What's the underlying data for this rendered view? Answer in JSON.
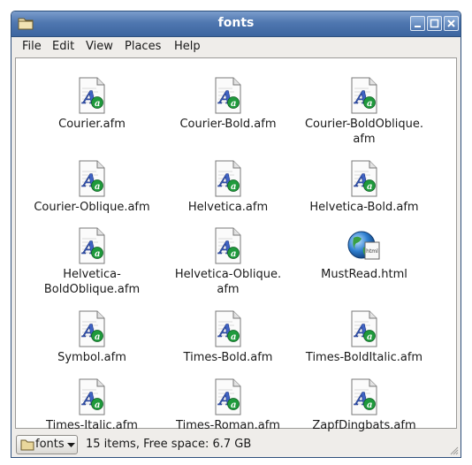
{
  "window": {
    "title": "fonts"
  },
  "menu": [
    "File",
    "Edit",
    "View",
    "Places",
    "Help"
  ],
  "files": [
    {
      "name": "Courier.afm",
      "icon": "font-file-icon"
    },
    {
      "name": "Courier-Bold.afm",
      "icon": "font-file-icon"
    },
    {
      "name": "Courier-BoldOblique.\nafm",
      "icon": "font-file-icon"
    },
    {
      "name": "Courier-Oblique.afm",
      "icon": "font-file-icon"
    },
    {
      "name": "Helvetica.afm",
      "icon": "font-file-icon"
    },
    {
      "name": "Helvetica-Bold.afm",
      "icon": "font-file-icon"
    },
    {
      "name": "Helvetica-\nBoldOblique.afm",
      "icon": "font-file-icon"
    },
    {
      "name": "Helvetica-Oblique.\nafm",
      "icon": "font-file-icon"
    },
    {
      "name": "MustRead.html",
      "icon": "html-file-icon",
      "badge": "html"
    },
    {
      "name": "Symbol.afm",
      "icon": "font-file-icon"
    },
    {
      "name": "Times-Bold.afm",
      "icon": "font-file-icon"
    },
    {
      "name": "Times-BoldItalic.afm",
      "icon": "font-file-icon"
    },
    {
      "name": "Times-Italic.afm",
      "icon": "font-file-icon"
    },
    {
      "name": "Times-Roman.afm",
      "icon": "font-file-icon"
    },
    {
      "name": "ZapfDingbats.afm",
      "icon": "font-file-icon"
    }
  ],
  "statusbar": {
    "location": "fonts",
    "info": "15 items, Free space: 6.7 GB"
  },
  "colors": {
    "titlebar": "#4f77b0",
    "window_bg": "#efedea",
    "content_bg": "#ffffff"
  }
}
